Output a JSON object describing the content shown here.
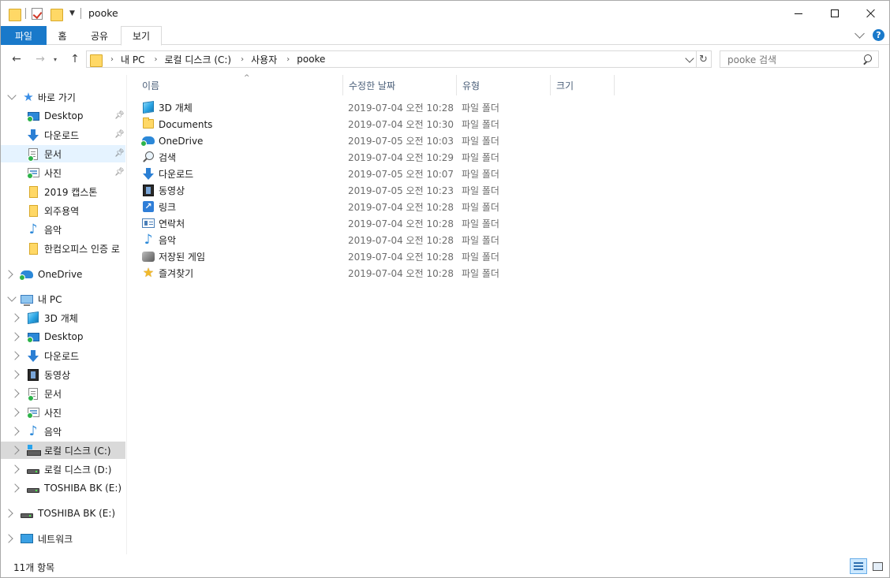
{
  "window": {
    "title": "pooke",
    "controls": {
      "minimize": "minimize-icon",
      "maximize": "maximize-icon",
      "close": "close-icon"
    }
  },
  "ribbon": {
    "tabs": [
      {
        "label": "파일",
        "active": true
      },
      {
        "label": "홈"
      },
      {
        "label": "공유"
      },
      {
        "label": "보기"
      }
    ],
    "help": "?"
  },
  "address": {
    "breadcrumbs": [
      "내 PC",
      "로컬 디스크 (C:)",
      "사용자",
      "pooke"
    ],
    "separator": "›"
  },
  "search": {
    "placeholder": "pooke 검색"
  },
  "sidebar": {
    "quick_access": {
      "label": "바로 가기"
    },
    "quick_items": [
      {
        "label": "Desktop",
        "icon": "desktop-icon",
        "pinned": true
      },
      {
        "label": "다운로드",
        "icon": "download-icon",
        "pinned": true
      },
      {
        "label": "문서",
        "icon": "document-icon",
        "pinned": true,
        "selected": true
      },
      {
        "label": "사진",
        "icon": "picture-icon",
        "pinned": true
      },
      {
        "label": "2019 캡스톤",
        "icon": "folder-icon"
      },
      {
        "label": "외주용역",
        "icon": "folder-icon"
      },
      {
        "label": "음악",
        "icon": "music-icon"
      },
      {
        "label": "한컴오피스 인증 로",
        "icon": "folder-icon"
      }
    ],
    "onedrive": {
      "label": "OneDrive"
    },
    "this_pc": {
      "label": "내 PC"
    },
    "pc_items": [
      {
        "label": "3D 개체",
        "icon": "3d-objects-icon"
      },
      {
        "label": "Desktop",
        "icon": "desktop-icon"
      },
      {
        "label": "다운로드",
        "icon": "download-icon"
      },
      {
        "label": "동영상",
        "icon": "video-icon"
      },
      {
        "label": "문서",
        "icon": "document-icon"
      },
      {
        "label": "사진",
        "icon": "picture-icon"
      },
      {
        "label": "음악",
        "icon": "music-icon"
      },
      {
        "label": "로컬 디스크 (C:)",
        "icon": "system-drive-icon",
        "selected": true
      },
      {
        "label": "로컬 디스크 (D:)",
        "icon": "drive-icon"
      },
      {
        "label": "TOSHIBA BK (E:)",
        "icon": "drive-icon"
      }
    ],
    "external_drive": {
      "label": "TOSHIBA BK (E:)"
    },
    "network": {
      "label": "네트워크"
    }
  },
  "columns": {
    "name": "이름",
    "modified": "수정한 날짜",
    "type": "유형",
    "size": "크기"
  },
  "files": [
    {
      "name": "3D 개체",
      "modified": "2019-07-04 오전 10:28",
      "type": "파일 폴더",
      "icon": "3d-objects-icon"
    },
    {
      "name": "Documents",
      "modified": "2019-07-04 오전 10:30",
      "type": "파일 폴더",
      "icon": "folder-icon"
    },
    {
      "name": "OneDrive",
      "modified": "2019-07-05 오전 10:03",
      "type": "파일 폴더",
      "icon": "onedrive-icon"
    },
    {
      "name": "검색",
      "modified": "2019-07-04 오전 10:29",
      "type": "파일 폴더",
      "icon": "search-folder-icon"
    },
    {
      "name": "다운로드",
      "modified": "2019-07-05 오전 10:07",
      "type": "파일 폴더",
      "icon": "download-icon"
    },
    {
      "name": "동영상",
      "modified": "2019-07-05 오전 10:23",
      "type": "파일 폴더",
      "icon": "video-icon"
    },
    {
      "name": "링크",
      "modified": "2019-07-04 오전 10:28",
      "type": "파일 폴더",
      "icon": "link-icon"
    },
    {
      "name": "연락처",
      "modified": "2019-07-04 오전 10:28",
      "type": "파일 폴더",
      "icon": "contacts-icon"
    },
    {
      "name": "음악",
      "modified": "2019-07-04 오전 10:28",
      "type": "파일 폴더",
      "icon": "music-icon"
    },
    {
      "name": "저장된 게임",
      "modified": "2019-07-04 오전 10:28",
      "type": "파일 폴더",
      "icon": "saved-games-icon"
    },
    {
      "name": "즐겨찾기",
      "modified": "2019-07-04 오전 10:28",
      "type": "파일 폴더",
      "icon": "favorites-icon"
    }
  ],
  "status": {
    "item_count": "11개 항목"
  },
  "colors": {
    "accent": "#1979ca",
    "selection": "#cce8ff",
    "column_header": "#4c607a",
    "secondary_text": "#6d6d6d"
  }
}
